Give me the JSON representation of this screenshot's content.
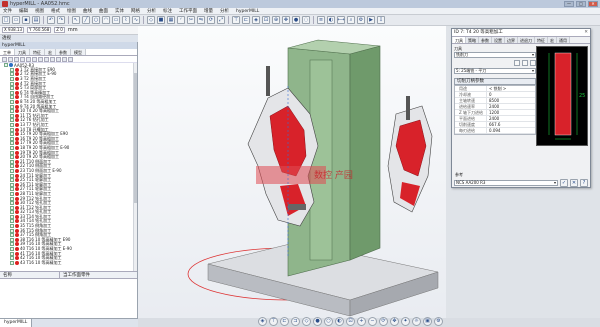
{
  "window": {
    "title": "hyperMILL - AA052.hmc"
  },
  "window_buttons": [
    "—",
    "□",
    "✕"
  ],
  "menu": [
    "文件",
    "编辑",
    "视图",
    "格式",
    "绘图",
    "曲线",
    "曲面",
    "实体",
    "网格",
    "分析",
    "标注",
    "工作平面",
    "增量",
    "分析",
    "hyperMILL"
  ],
  "coordbar": {
    "x": "X 938.13",
    "y": "Y 760.568",
    "z": "Z 0",
    "unit": "mm"
  },
  "view_label": "透视",
  "left_panel": {
    "title": "hyperMILL",
    "tabs": [
      "工单",
      "刀具",
      "特征",
      "宏",
      "参数",
      "模型"
    ],
    "tree": [
      {
        "label": "AA052-R3",
        "root": true,
        "indent": 0
      },
      {
        "label": "1 T2 直接加工 E90",
        "indent": 1
      },
      {
        "label": "2 T2 直接加工 E-90",
        "indent": 1
      },
      {
        "label": "3 T2 直接加工",
        "indent": 1
      },
      {
        "label": "4 T2 直接加工",
        "indent": 1
      },
      {
        "label": "5 T3 局部加工",
        "indent": 1
      },
      {
        "label": "6 T4 等高精加工",
        "indent": 1
      },
      {
        "label": "7 T4 自由路径加工",
        "indent": 1
      },
      {
        "label": "8 T4 20 等高粗加工",
        "indent": 1
      },
      {
        "label": "9 T4 20 等高粗加工",
        "indent": 1
      },
      {
        "label": "10 T4 20 等高粗加工",
        "indent": 1
      },
      {
        "label": "11 T5 钻孔加工",
        "indent": 1
      },
      {
        "label": "12 T6 钻孔加工",
        "indent": 1
      },
      {
        "label": "13 T7 钻孔加工",
        "indent": 1
      },
      {
        "label": "14 T8 开槽加工",
        "indent": 1
      },
      {
        "label": "15 T9 20 等高粗加工 E90",
        "indent": 1
      },
      {
        "label": "16 T9 20 等高粗加工",
        "indent": 1
      },
      {
        "label": "17 T9 20 等高粗加工",
        "indent": 1
      },
      {
        "label": "18 T9 20 等高粗加工 E-90",
        "indent": 1
      },
      {
        "label": "19 T9 20 等高粗加工",
        "indent": 1
      },
      {
        "label": "20 T9 20 等高粗加工",
        "indent": 1
      },
      {
        "label": "21 T10 侧面加工",
        "indent": 1
      },
      {
        "label": "22 T10 侧面加工",
        "indent": 1
      },
      {
        "label": "23 T10 侧面加工 E-90",
        "indent": 1
      },
      {
        "label": "24 T11 轮廓加工",
        "indent": 1
      },
      {
        "label": "25 T11 轮廓加工",
        "indent": 1
      },
      {
        "label": "26 T11 轮廓加工",
        "indent": 1
      },
      {
        "label": "27 T11 轮廓加工",
        "indent": 1
      },
      {
        "label": "28 T11 轮廓加工",
        "indent": 1
      },
      {
        "label": "29 T12 钻孔加工",
        "indent": 1
      },
      {
        "label": "30 T12 钻孔加工",
        "indent": 1
      },
      {
        "label": "31 T12 钻孔加工",
        "indent": 1
      },
      {
        "label": "32 T13 钻孔加工",
        "indent": 1
      },
      {
        "label": "33 T14 钻孔加工",
        "indent": 1
      },
      {
        "label": "34 T14 钻孔加工",
        "indent": 1
      },
      {
        "label": "35 T15 倒角加工",
        "indent": 1
      },
      {
        "label": "36 T15 倒角加工",
        "indent": 1
      },
      {
        "label": "37 T15 倒角加工",
        "indent": 1
      },
      {
        "label": "38 T16 10 等高精加工 E90",
        "indent": 1
      },
      {
        "label": "39 T16 10 等高精加工",
        "indent": 1
      },
      {
        "label": "40 T16 10 等高精加工 E-90",
        "indent": 1
      },
      {
        "label": "41 T16 10 等高精加工",
        "indent": 1
      },
      {
        "label": "42 T16 10 等高精加工",
        "indent": 1
      },
      {
        "label": "43 T16 10 等高精加工",
        "indent": 1
      }
    ],
    "prop_headers": [
      "名称",
      "当工作面零件"
    ],
    "bottom_tab": "hyperMILL"
  },
  "viewport": {
    "watermark": "数控 产园"
  },
  "dialog": {
    "title": "ID 7: T4 20 等高粗加工",
    "tabs": [
      "刀具",
      "策略",
      "参数",
      "设置",
      "边界",
      "进退刀",
      "特征",
      "宏",
      "通用"
    ],
    "tool_label": "刀具",
    "tool_select": "铣削刀",
    "tool_name": "5: 25端铣 - 平刀",
    "section_title": "切削刀柄参数",
    "params": [
      {
        "k": "用途",
        "v": "< 铣削 >"
      },
      {
        "k": "冷却液",
        "v": "0"
      },
      {
        "k": "主轴转速",
        "v": "8500"
      },
      {
        "k": "进给速率",
        "v": "2400"
      },
      {
        "k": "Z 轴下刀进给",
        "v": "1200"
      },
      {
        "k": "平面进给",
        "v": "2400"
      },
      {
        "k": "切削速度",
        "v": "667.6"
      },
      {
        "k": "每刃进给",
        "v": "0.094"
      }
    ],
    "foot_label": "参考",
    "foot_select": "NCS AA200 R3",
    "dim_label": "25"
  },
  "colors": {
    "accent": "#c2302d",
    "fixture": "#8fb58b",
    "base": "#c9cbd0",
    "part_red": "#d8222a"
  }
}
